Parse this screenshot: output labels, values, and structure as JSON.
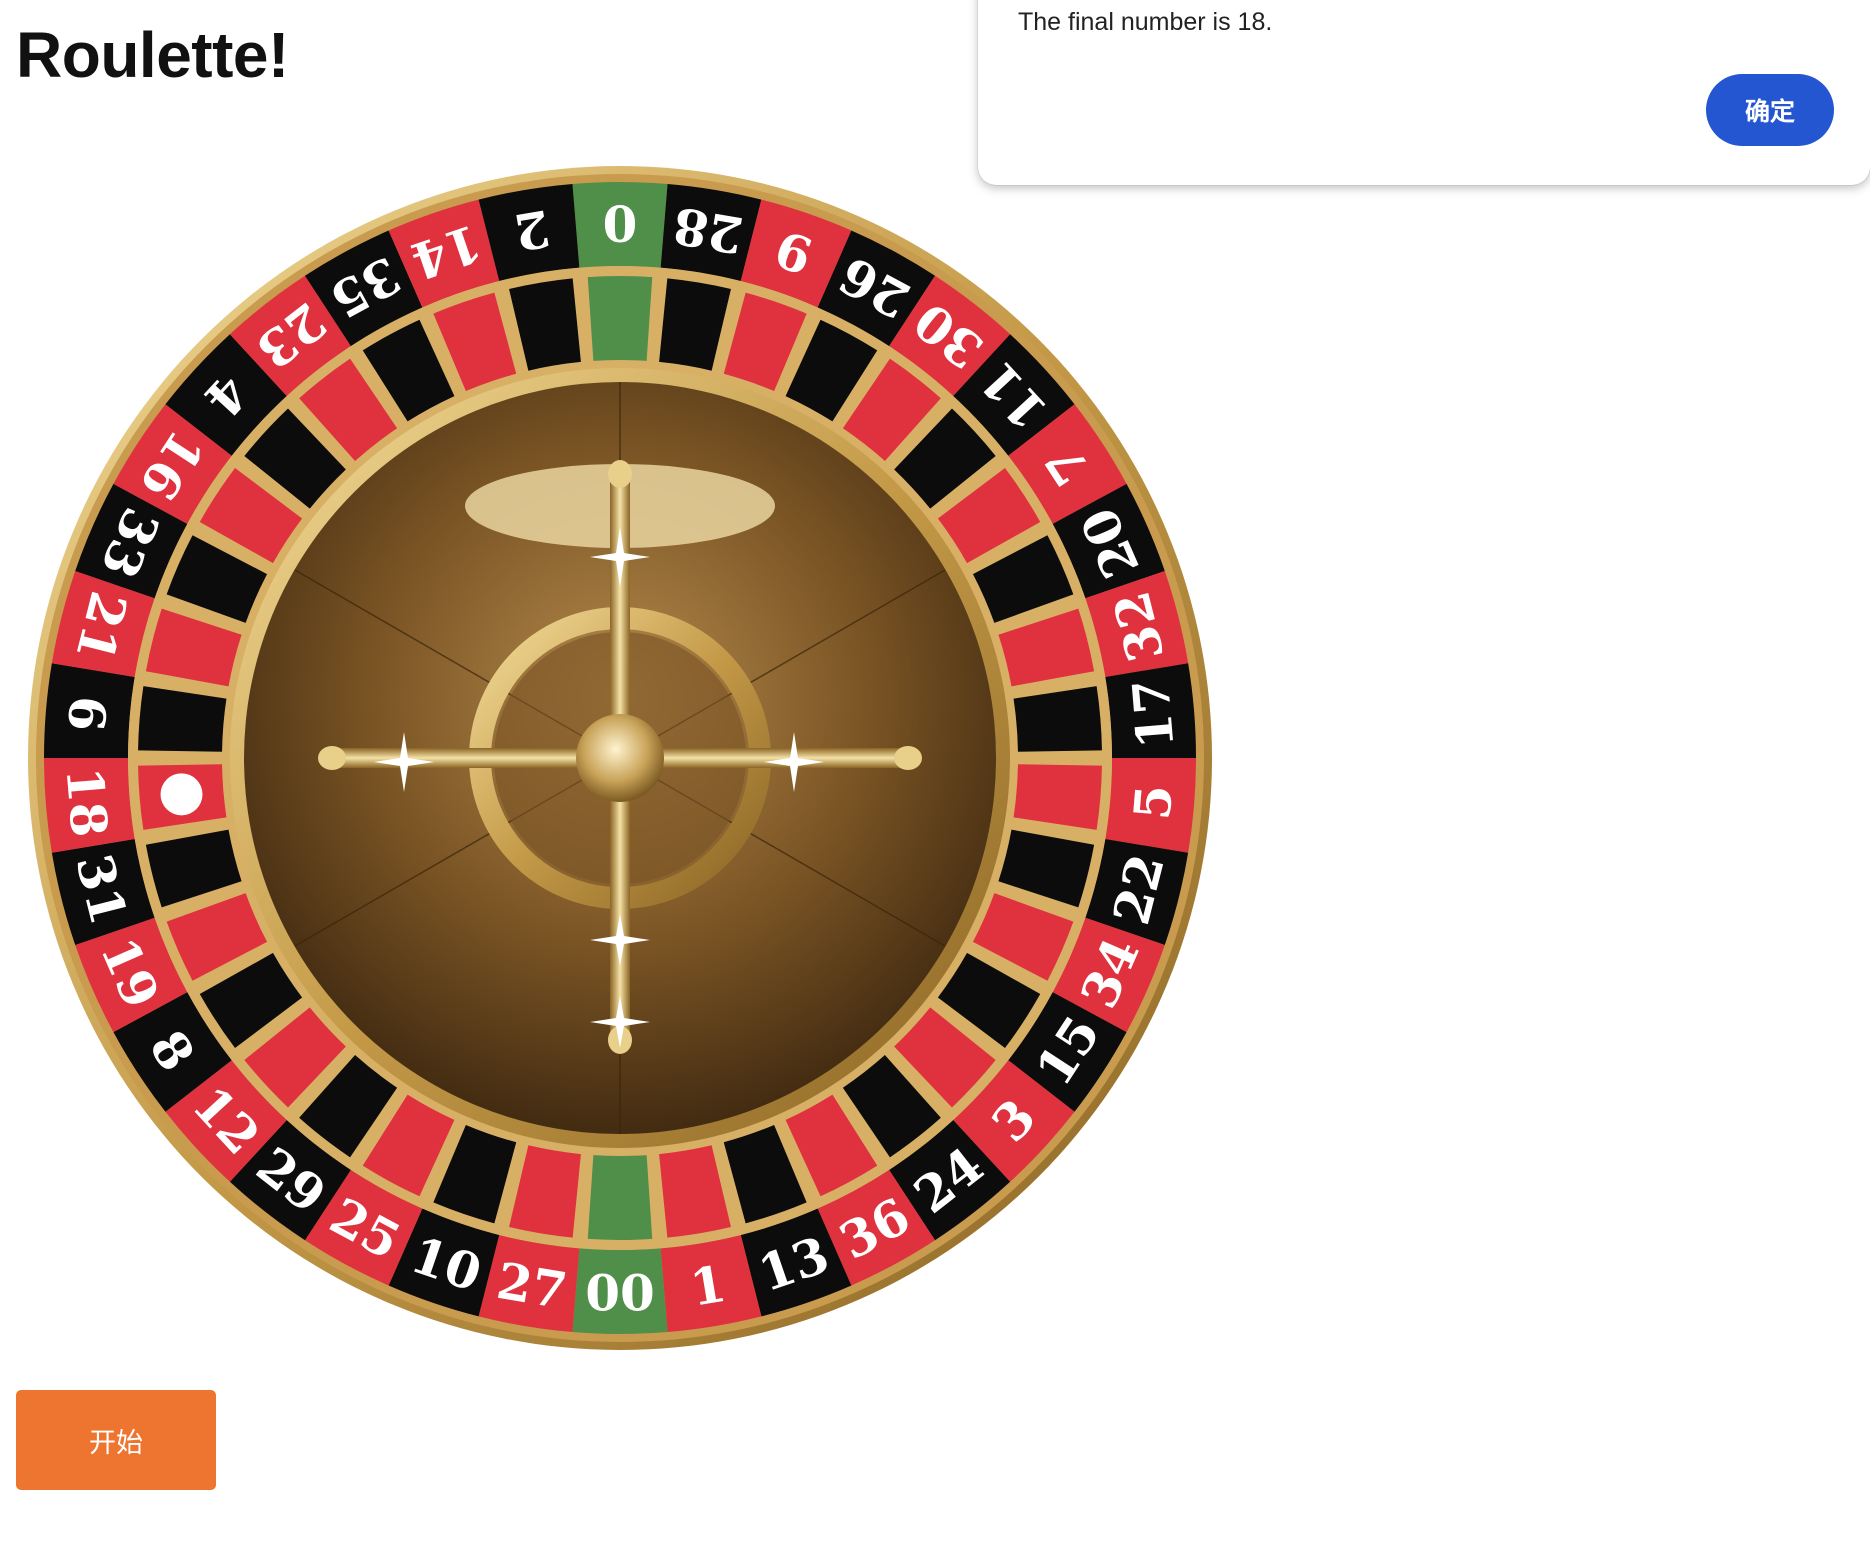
{
  "page": {
    "title": "Roulette!"
  },
  "wheel": {
    "pockets": [
      "0",
      "28",
      "9",
      "26",
      "30",
      "11",
      "7",
      "20",
      "32",
      "17",
      "5",
      "22",
      "34",
      "15",
      "3",
      "24",
      "36",
      "13",
      "1",
      "00",
      "27",
      "10",
      "25",
      "29",
      "12",
      "8",
      "19",
      "31",
      "18",
      "6",
      "21",
      "33",
      "16",
      "4",
      "23",
      "35",
      "14",
      "2"
    ],
    "pocket_colors": [
      "green",
      "black",
      "red",
      "black",
      "red",
      "black",
      "red",
      "black",
      "red",
      "black",
      "red",
      "black",
      "red",
      "black",
      "red",
      "black",
      "red",
      "black",
      "red",
      "green",
      "red",
      "black",
      "red",
      "black",
      "red",
      "black",
      "red",
      "black",
      "red",
      "black",
      "red",
      "black",
      "red",
      "black",
      "red",
      "black",
      "red",
      "black"
    ],
    "ball_pocket": "18",
    "colors": {
      "red": "#e0323e",
      "black": "#0c0c0c",
      "green": "#4f8f4a",
      "gold": "#d4a955",
      "bowl": "#6e4a20"
    }
  },
  "controls": {
    "start_label": "开始"
  },
  "alert": {
    "message": "The final number is 18.",
    "ok_label": "确定",
    "accent_color": "#2556d1"
  }
}
